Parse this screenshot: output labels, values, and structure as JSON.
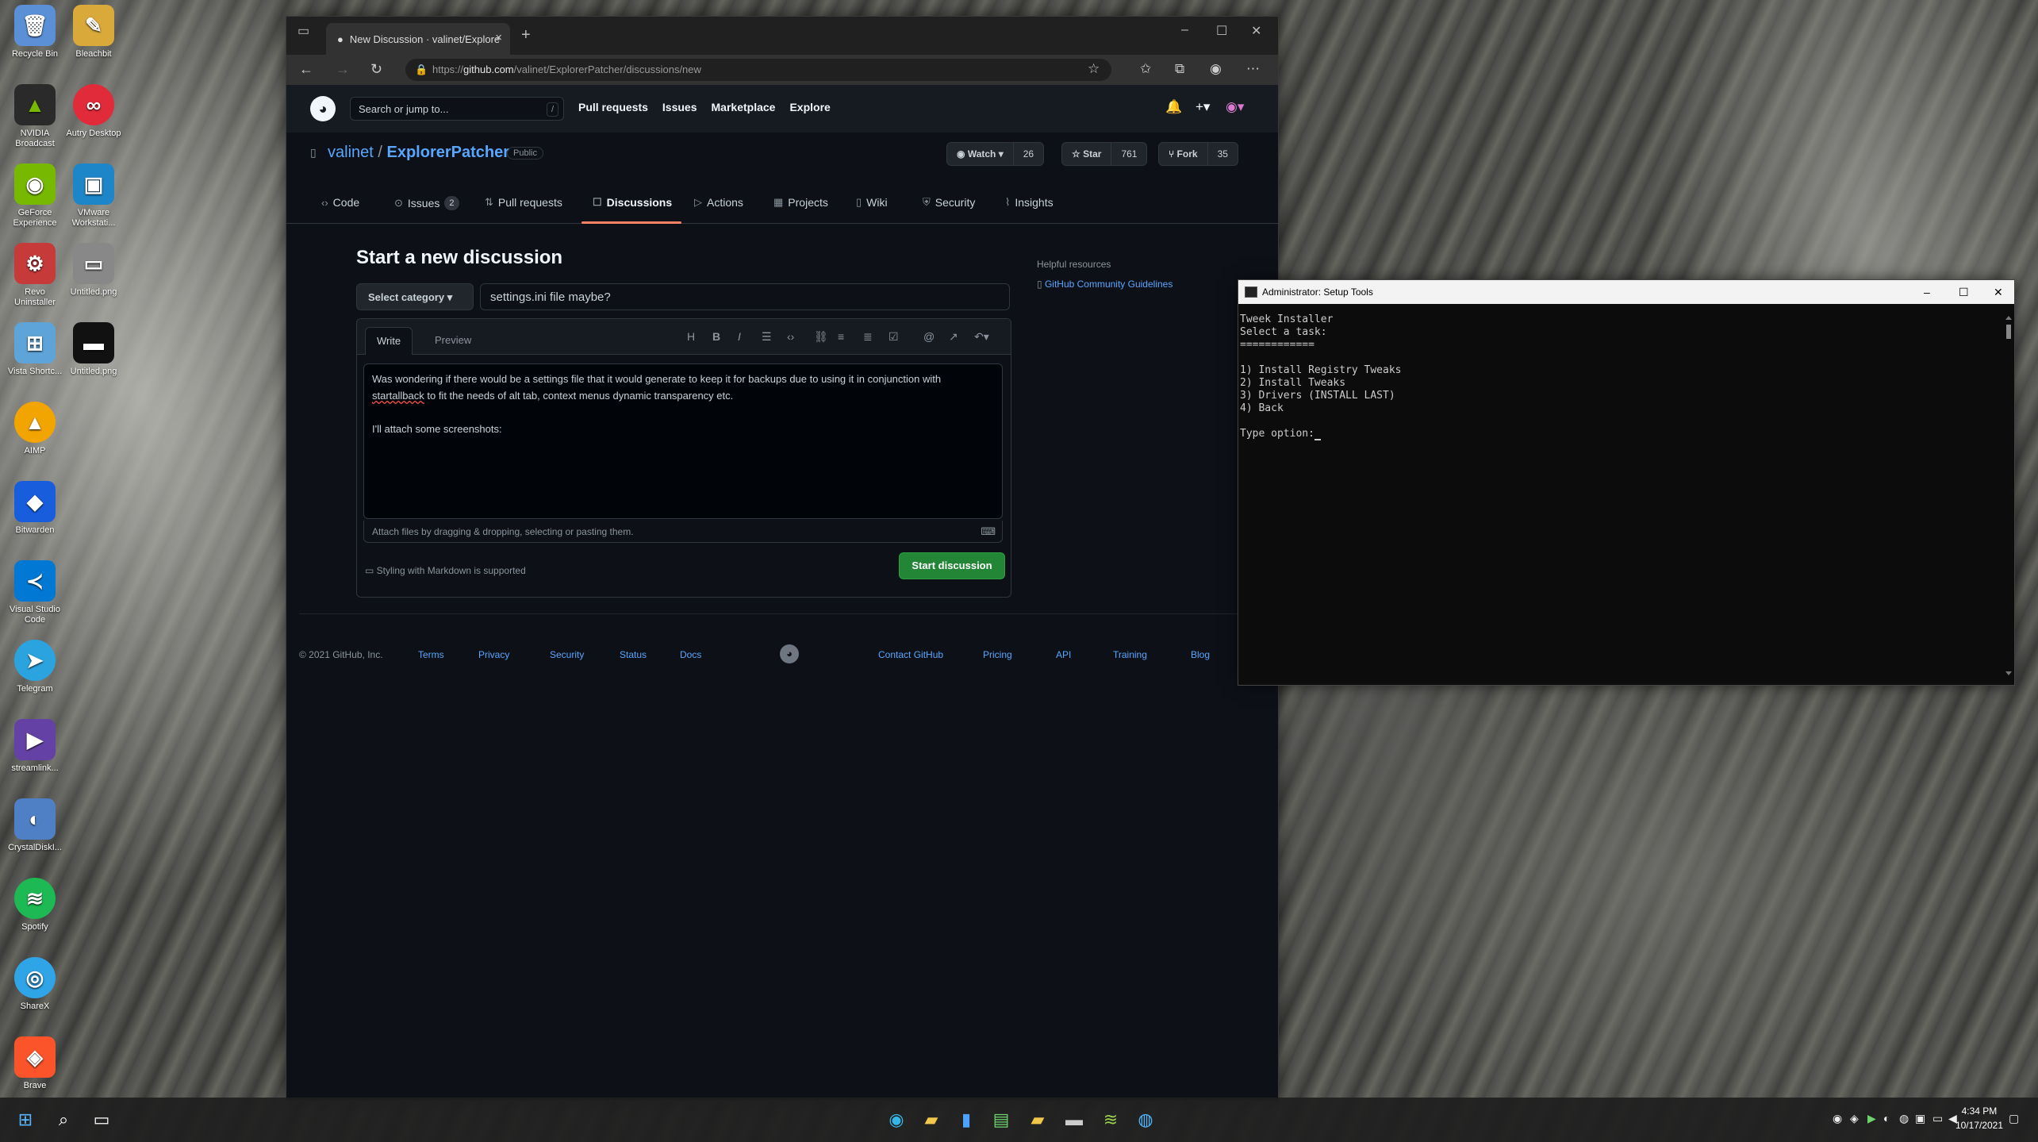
{
  "desktop": {
    "icons": [
      {
        "label": "Recycle Bin",
        "glyph": "🗑",
        "color": "#5b8fd6"
      },
      {
        "label": "Bleachbit",
        "glyph": "✎",
        "color": "#d9a93a"
      },
      {
        "label": "NVIDIA Broadcast",
        "glyph": "▲",
        "color": "#76b900"
      },
      {
        "label": "Autry Desktop",
        "glyph": "∞",
        "color": "#e22b3a"
      },
      {
        "label": "GeForce Experience",
        "glyph": "◉",
        "color": "#76b900"
      },
      {
        "label": "VMware Workstati...",
        "glyph": "▣",
        "color": "#1d86c9"
      },
      {
        "label": "Revo Uninstaller",
        "glyph": "⚙",
        "color": "#c63a3a"
      },
      {
        "label": "Untitled.png",
        "glyph": "▭",
        "color": "#888888"
      },
      {
        "label": "Vista Shortc...",
        "glyph": "⊞",
        "color": "#5ea4d8"
      },
      {
        "label": "Untitled.png",
        "glyph": "▬",
        "color": "#111111"
      },
      {
        "label": "AIMP",
        "glyph": "▲",
        "color": "#f2a400"
      },
      {
        "label": "Bitwarden",
        "glyph": "◆",
        "color": "#175ddc"
      },
      {
        "label": "Visual Studio Code",
        "glyph": "≺",
        "color": "#0078d4"
      },
      {
        "label": "Telegram",
        "glyph": "➤",
        "color": "#2aa3df"
      },
      {
        "label": "streamlink...",
        "glyph": "▶",
        "color": "#6441a5"
      },
      {
        "label": "CrystalDiskI...",
        "glyph": "◐",
        "color": "#4f7fc4"
      },
      {
        "label": "Spotify",
        "glyph": "≋",
        "color": "#1db954"
      },
      {
        "label": "ShareX",
        "glyph": "◎",
        "color": "#2fa4e7"
      },
      {
        "label": "Brave",
        "glyph": "◈",
        "color": "#fb542b"
      }
    ]
  },
  "browser": {
    "tab_title": "New Discussion · valinet/Explore",
    "url_prefix": "https://",
    "url_host": "github.com",
    "url_path": "/valinet/ExplorerPatcher/discussions/new"
  },
  "github": {
    "search_placeholder": "Search or jump to...",
    "search_hint": "/",
    "nav": [
      "Pull requests",
      "Issues",
      "Marketplace",
      "Explore"
    ],
    "owner": "valinet",
    "separator": "/",
    "repo": "ExplorerPatcher",
    "visibility": "Public",
    "watch_label": "Watch",
    "watch_count": "26",
    "star_label": "Star",
    "star_count": "761",
    "fork_label": "Fork",
    "fork_count": "35",
    "tabs": [
      {
        "label": "Code",
        "icon": "‹›"
      },
      {
        "label": "Issues",
        "icon": "⊙",
        "count": "2"
      },
      {
        "label": "Pull requests",
        "icon": "⇅"
      },
      {
        "label": "Discussions",
        "icon": "☐"
      },
      {
        "label": "Actions",
        "icon": "▷"
      },
      {
        "label": "Projects",
        "icon": "▦"
      },
      {
        "label": "Wiki",
        "icon": "▯"
      },
      {
        "label": "Security",
        "icon": "⛨"
      },
      {
        "label": "Insights",
        "icon": "⌇"
      }
    ]
  },
  "discussion": {
    "heading": "Start a new discussion",
    "category_label": "Select category",
    "title_value": "settings.ini file maybe?",
    "write_tab": "Write",
    "preview_tab": "Preview",
    "body_line1_a": "Was wondering if there would be a settings file that it would generate to keep it for backups due to using it in conjunction with",
    "body_line1_b": "startallback",
    "body_line1_c": " to fit the needs of alt tab, context menus dynamic transparency etc.",
    "body_line2": "I'll attach some screenshots:",
    "attach_text": "Attach files by dragging & dropping, selecting or pasting them.",
    "markdown_note": "Styling with Markdown is supported",
    "submit_label": "Start discussion",
    "helpful_heading": "Helpful resources",
    "helpful_link": "GitHub Community Guidelines"
  },
  "footer": {
    "copyright": "© 2021 GitHub, Inc.",
    "links_left": [
      "Terms",
      "Privacy",
      "Security",
      "Status",
      "Docs"
    ],
    "links_right": [
      "Contact GitHub",
      "Pricing",
      "API",
      "Training",
      "Blog"
    ]
  },
  "terminal": {
    "title": "Administrator:  Setup Tools",
    "lines": [
      "Tweek Installer",
      "Select a task:",
      "============",
      "",
      "1) Install Registry Tweaks",
      "2) Install Tweaks",
      "3) Drivers (INSTALL LAST)",
      "4) Back",
      "",
      "Type option:"
    ]
  },
  "taskbar": {
    "time": "4:34 PM",
    "date": "10/17/2021"
  },
  "colors": {
    "accent_green": "#238636",
    "link_blue": "#58a6ff",
    "tab_underline": "#f78166"
  }
}
